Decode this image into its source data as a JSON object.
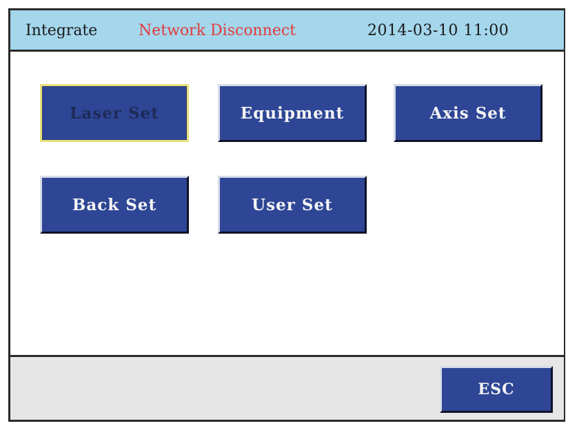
{
  "titlebar": {
    "mode": "Integrate",
    "status": "Network Disconnect",
    "datetime": "2014-03-10 11:00"
  },
  "menu": {
    "laser_set": "Laser Set",
    "equipment": "Equipment",
    "axis_set": "Axis Set",
    "back_set": "Back Set",
    "user_set": "User Set"
  },
  "footer": {
    "esc": "ESC"
  },
  "colors": {
    "titlebar_bg": "#a4d6ec",
    "status_text": "#e23a3a",
    "button_bg": "#2e4695",
    "selected_border": "#e8e07a",
    "footer_bg": "#e6e6e6"
  }
}
